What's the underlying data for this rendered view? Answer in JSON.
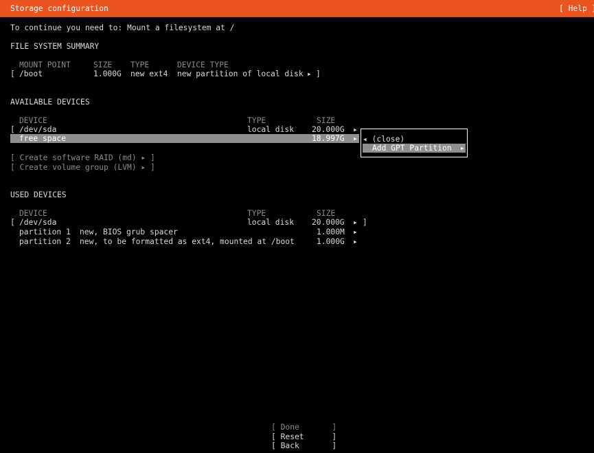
{
  "window": {
    "title": "Storage configuration",
    "help": "[ Help ]"
  },
  "message": "To continue you need to: Mount a filesystem at /",
  "fs_summary": {
    "heading": "FILE SYSTEM SUMMARY",
    "headers": {
      "mount_point": "MOUNT POINT",
      "size": "SIZE",
      "type": "TYPE",
      "device_type": "DEVICE TYPE"
    },
    "rows": [
      {
        "open": "[",
        "mount_point": "/boot",
        "size": "1.000G",
        "type": "new ext4",
        "device_type": "new partition of local disk",
        "arrow": "▸",
        "close": "]"
      }
    ]
  },
  "available": {
    "heading": "AVAILABLE DEVICES",
    "headers": {
      "device": "DEVICE",
      "type": "TYPE",
      "size": "SIZE"
    },
    "disk": {
      "open": "[",
      "name": "/dev/sda",
      "type": "local disk",
      "size": "20.000G",
      "arrow": "▸"
    },
    "free": {
      "name": "free space",
      "size": "18.997G",
      "arrow": "▸"
    },
    "actions": [
      "[ Create software RAID (md) ▸ ]",
      "[ Create volume group (LVM) ▸ ]"
    ]
  },
  "popup": {
    "close_label": "◂ (close)",
    "add_label": "Add GPT Partition",
    "add_arrow": "▸"
  },
  "used": {
    "heading": "USED DEVICES",
    "headers": {
      "device": "DEVICE",
      "type": "TYPE",
      "size": "SIZE"
    },
    "disk": {
      "open": "[",
      "name": "/dev/sda",
      "type": "local disk",
      "size": "20.000G",
      "arrow": "▸",
      "close": "]"
    },
    "partitions": [
      {
        "name": "partition 1",
        "desc": "new, BIOS grub spacer",
        "size": "1.000M",
        "arrow": "▸"
      },
      {
        "name": "partition 2",
        "desc": "new, to be formatted as ext4, mounted at /boot",
        "size": "1.000G",
        "arrow": "▸"
      }
    ]
  },
  "buttons": {
    "done": "[ Done       ]",
    "reset": "[ Reset      ]",
    "back": "[ Back       ]"
  },
  "colors": {
    "titlebar": "#E95420",
    "background": "#000000",
    "highlight": "#8e8e8e"
  }
}
